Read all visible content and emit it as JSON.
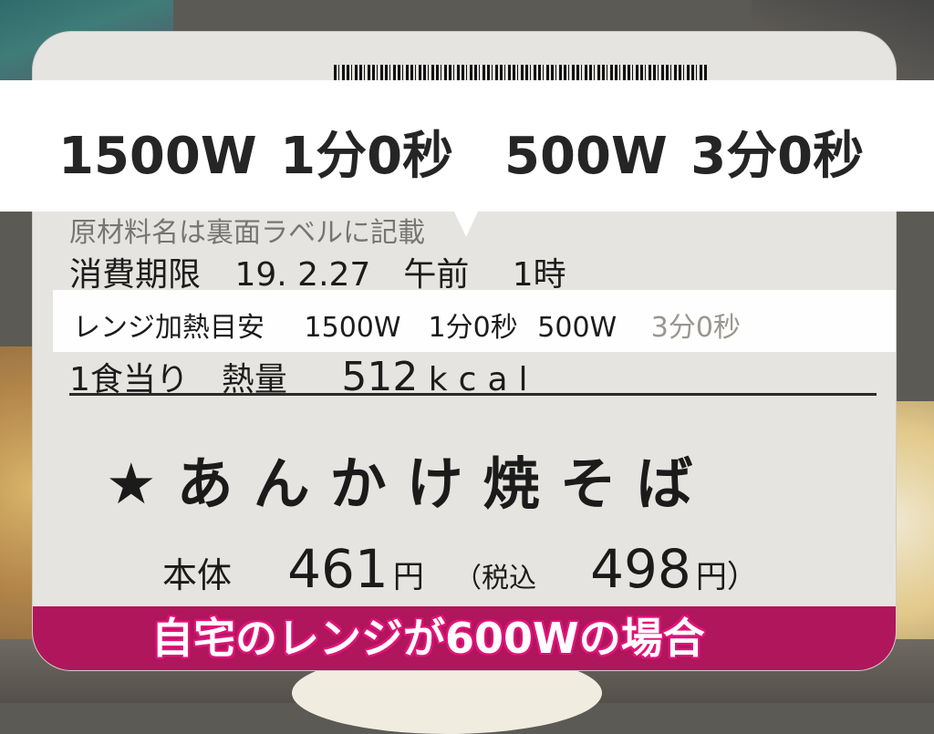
{
  "banner": {
    "text": "1500W 1分0秒　500W 3分0秒"
  },
  "label": {
    "ingredients_line": "原材料名は裏面ラベルに記載",
    "expiry_label": "消費期限",
    "expiry_value": "19. 2.27　午前　 1時",
    "microwave_label": "レンジ加熱目安",
    "microwave_high": "1500W　1分0秒",
    "microwave_low": "500W",
    "microwave_low_time": "3分0秒",
    "calorie_label": "1食当り　熱量",
    "calorie_value": "512",
    "calorie_unit": "kcal",
    "product_name": "★あんかけ焼そば",
    "price_label": "本体",
    "price_value": "461",
    "price_unit": "円",
    "tax_label": "（税込",
    "tax_value": "498",
    "tax_unit": "円）"
  },
  "caption": {
    "text": "自宅のレンジが600Wの場合"
  },
  "colors": {
    "band": "#b0165c",
    "caption_outline": "#e0157a"
  }
}
